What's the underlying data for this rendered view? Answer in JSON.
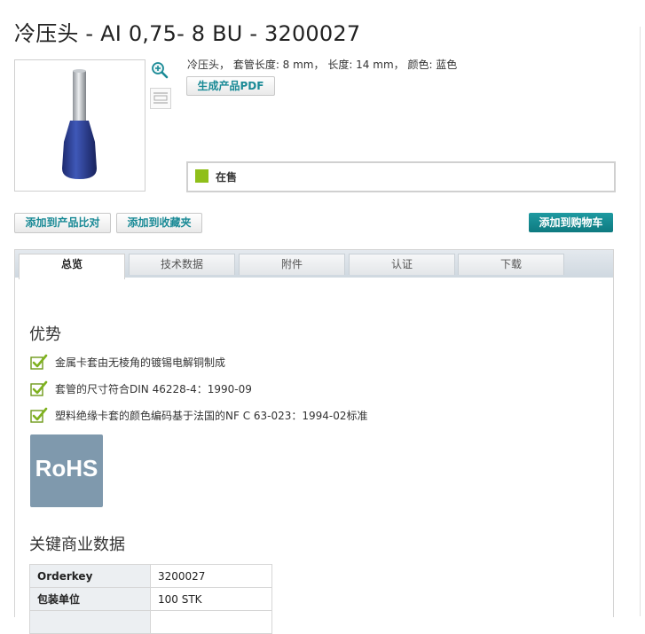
{
  "title": "冷压头 - AI 0,75- 8 BU - 3200027",
  "product": {
    "description": "冷压头， 套管长度: 8 mm， 长度: 14 mm， 颜色: 蓝色",
    "pdf_button": "生成产品PDF",
    "stock_status": "在售",
    "stock_color": "#8fbf1a"
  },
  "icons": {
    "zoom": "zoom-in-icon",
    "dimensions": "dimension-drawing-icon"
  },
  "actions": {
    "compare": "添加到产品比对",
    "favorites": "添加到收藏夹",
    "cart": "添加到购物车"
  },
  "tabs": [
    "总览",
    "技术数据",
    "附件",
    "认证",
    "下载"
  ],
  "active_tab": "总览",
  "advantages": {
    "heading": "优势",
    "items": [
      "金属卡套由无棱角的镀锡电解铜制成",
      "套管的尺寸符合DIN 46228-4：1990-09",
      "塑料绝缘卡套的颜色编码基于法国的NF C 63-023：1994-02标准"
    ]
  },
  "rohs_label": "RoHS",
  "commercial": {
    "heading": "关键商业数据",
    "rows": [
      {
        "key": "Orderkey",
        "value": "3200027"
      },
      {
        "key": "包装单位",
        "value": "100 STK"
      }
    ]
  },
  "colors": {
    "accent": "#1a8a96",
    "cart_button": "#13868c",
    "rohs_badge": "#7f99ad"
  }
}
